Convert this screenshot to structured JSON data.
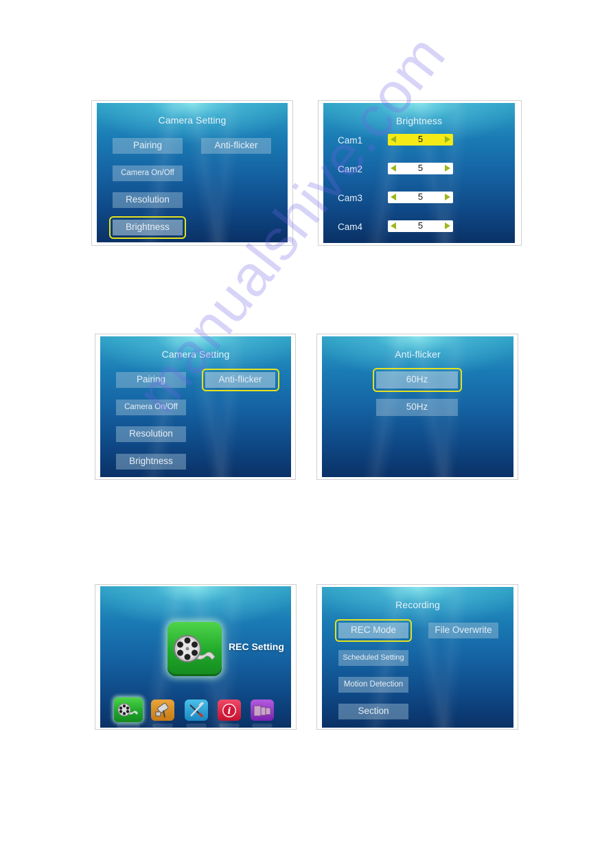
{
  "panels": {
    "camera_setting_1": {
      "title": "Camera Setting",
      "buttons": [
        "Pairing",
        "Anti-flicker",
        "Camera On/Off",
        "Resolution",
        "Brightness"
      ],
      "selected": "Brightness"
    },
    "brightness": {
      "title": "Brightness",
      "rows": [
        {
          "label": "Cam1",
          "value": "5",
          "active": true
        },
        {
          "label": "Cam2",
          "value": "5",
          "active": false
        },
        {
          "label": "Cam3",
          "value": "5",
          "active": false
        },
        {
          "label": "Cam4",
          "value": "5",
          "active": false
        }
      ]
    },
    "camera_setting_2": {
      "title": "Camera Setting",
      "buttons": [
        "Pairing",
        "Anti-flicker",
        "Camera On/Off",
        "Resolution",
        "Brightness"
      ],
      "selected": "Anti-flicker"
    },
    "anti_flicker": {
      "title": "Anti-flicker",
      "options": [
        "60Hz",
        "50Hz"
      ],
      "selected": "60Hz"
    },
    "main_menu": {
      "featured_label": "REC Setting",
      "featured_icon": "film-reel-icon",
      "dock": [
        {
          "icon": "film-reel-icon",
          "color": "#1fa82a",
          "selected": true
        },
        {
          "icon": "security-camera-icon",
          "color": "#c77a14",
          "selected": false
        },
        {
          "icon": "tools-icon",
          "color": "#1a88c4",
          "selected": false
        },
        {
          "icon": "info-icon",
          "color": "#c3122f",
          "selected": false
        },
        {
          "icon": "film-strip-icon",
          "color": "#7b22b0",
          "selected": false
        }
      ]
    },
    "recording": {
      "title": "Recording",
      "buttons": [
        "REC Mode",
        "File Overwrite",
        "Scheduled Setting",
        "Motion Detection",
        "Section"
      ],
      "selected": "REC Mode"
    }
  },
  "colors": {
    "highlight": "#e6e21f",
    "spinner_active": "#f3ea16",
    "spinner_arrow": "#9cb81a"
  },
  "watermark": "manualshive.com"
}
